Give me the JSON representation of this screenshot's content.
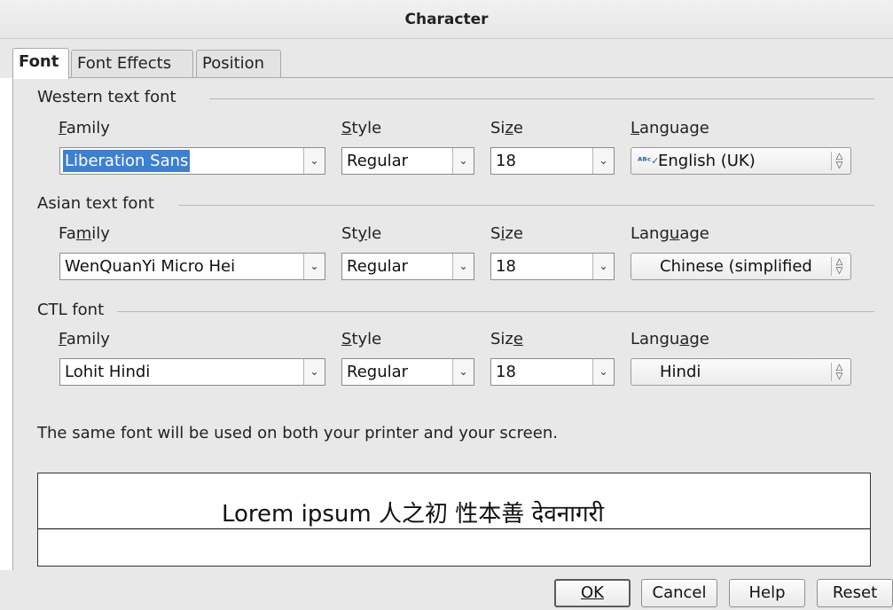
{
  "window": {
    "title": "Character"
  },
  "tabs": [
    {
      "label": "Font",
      "active": true
    },
    {
      "label": "Font Effects",
      "active": false
    },
    {
      "label": "Position",
      "active": false
    }
  ],
  "western": {
    "title": "Western text font",
    "family_label": "Family",
    "style_label": "Style",
    "size_label": "Size",
    "language_label": "Language",
    "family": "Liberation Sans",
    "style": "Regular",
    "size": "18",
    "language": "English (UK)",
    "language_icon": "spellcheck-icon"
  },
  "asian": {
    "title": "Asian text font",
    "family_label": "Family",
    "style_label": "Style",
    "size_label": "Size",
    "language_label": "Language",
    "family": "WenQuanYi Micro Hei",
    "style": "Regular",
    "size": "18",
    "language": "Chinese (simplified"
  },
  "ctl": {
    "title": "CTL font",
    "family_label": "Family",
    "style_label": "Style",
    "size_label": "Size",
    "language_label": "Language",
    "family": "Lohit Hindi",
    "style": "Regular",
    "size": "18",
    "language": "Hindi"
  },
  "info_text": "The same font will be used on both your printer and your screen.",
  "preview": {
    "text": "Lorem ipsum   人之初 性本善   देवनागरी"
  },
  "buttons": {
    "ok": "OK",
    "cancel": "Cancel",
    "help": "Help",
    "reset": "Reset"
  },
  "colors": {
    "selection": "#3d7fd1",
    "panel": "#e8e8e8"
  }
}
